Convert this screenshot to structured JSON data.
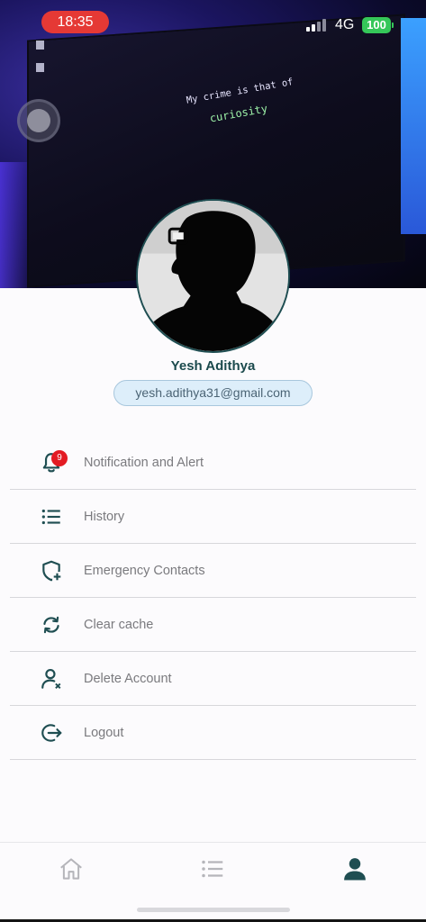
{
  "status_bar": {
    "time": "18:35",
    "network": "4G",
    "battery": "100"
  },
  "hero": {
    "quote_line1": "My crime is that of",
    "quote_line2": "curiosity"
  },
  "profile": {
    "name": "Yesh Adithya",
    "email": "yesh.adithya31@gmail.com"
  },
  "menu": {
    "items": [
      {
        "label": "Notification and Alert",
        "icon": "bell-icon",
        "badge": "9"
      },
      {
        "label": "History",
        "icon": "list-icon"
      },
      {
        "label": "Emergency Contacts",
        "icon": "shield-plus-icon"
      },
      {
        "label": "Clear cache",
        "icon": "refresh-icon"
      },
      {
        "label": "Delete Account",
        "icon": "user-remove-icon"
      },
      {
        "label": "Logout",
        "icon": "logout-icon"
      }
    ]
  },
  "bottom_nav": {
    "items": [
      {
        "icon": "home-icon",
        "active": false
      },
      {
        "icon": "list-icon",
        "active": false
      },
      {
        "icon": "profile-icon",
        "active": true
      }
    ]
  },
  "colors": {
    "accent": "#1f4e52",
    "badge": "#e31b23",
    "time_pill": "#e53935",
    "battery": "#35c759",
    "email_pill": "#ddeefa"
  }
}
